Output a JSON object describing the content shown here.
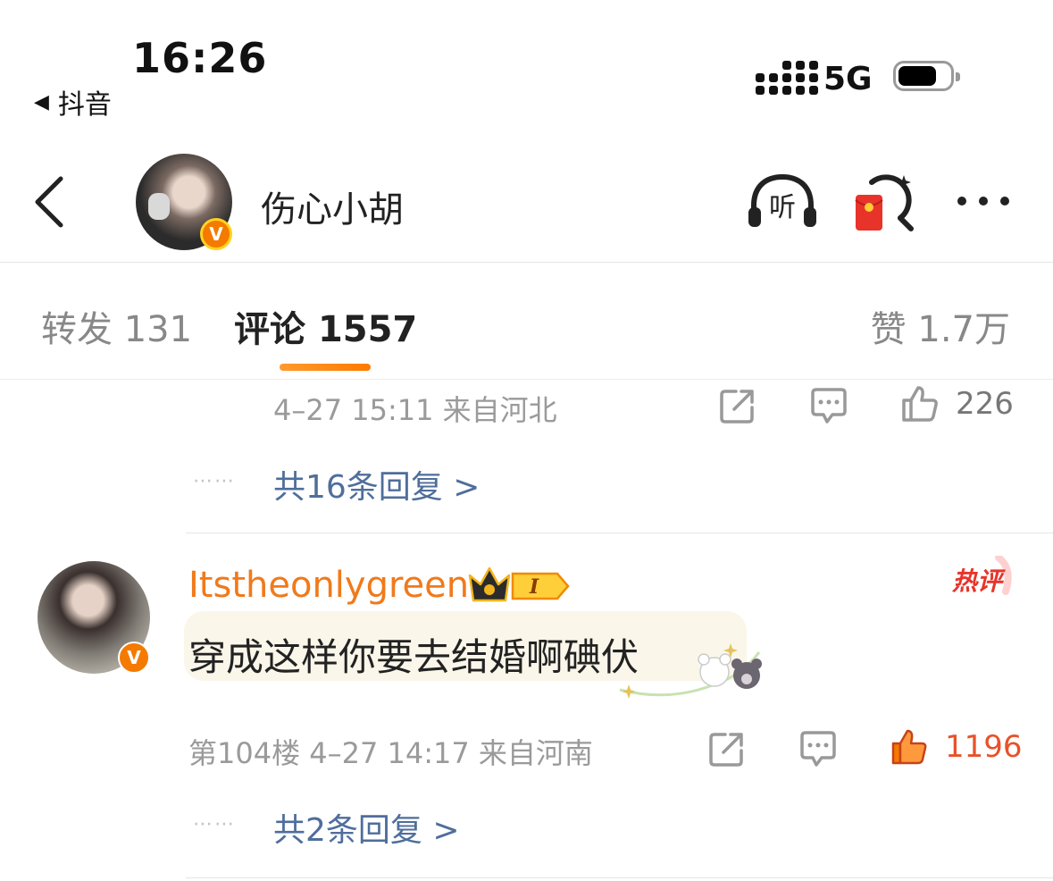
{
  "status_bar": {
    "time": "16:26",
    "back_app": "抖音",
    "back_arrow": "◀",
    "network": "5G"
  },
  "header": {
    "username": "伤心小胡",
    "verified_badge": "V",
    "listen_label": "听",
    "icons": [
      "back-chevron-icon",
      "headphones-icon",
      "red-packet-search-icon",
      "more-icon"
    ]
  },
  "tabs": {
    "repost_label": "转发",
    "repost_count": "131",
    "comment_label": "评论",
    "comment_count": "1557",
    "like_label": "赞",
    "like_count": "1.7万",
    "active_color": "#ff8a00"
  },
  "comments": [
    {
      "meta": "4–27 15:11 来自河北",
      "like_count": "226",
      "replies_dots": "⋯⋯",
      "replies_text": "共16条回复 >"
    },
    {
      "username": "Itstheonlygreen",
      "level_badge": "I",
      "hot_badge": "热评",
      "text": "穿成这样你要去结婚啊碘伏",
      "floor": "第104楼",
      "meta": "4–27 14:17 来自河南",
      "like_count": "1196",
      "liked": true,
      "verified_badge": "V",
      "replies_dots": "⋯⋯",
      "replies_text": "共2条回复 >"
    }
  ],
  "colors": {
    "username_orange": "#f07a1b",
    "link_blue": "#4f6e9b",
    "liked_red": "#e8522a"
  }
}
